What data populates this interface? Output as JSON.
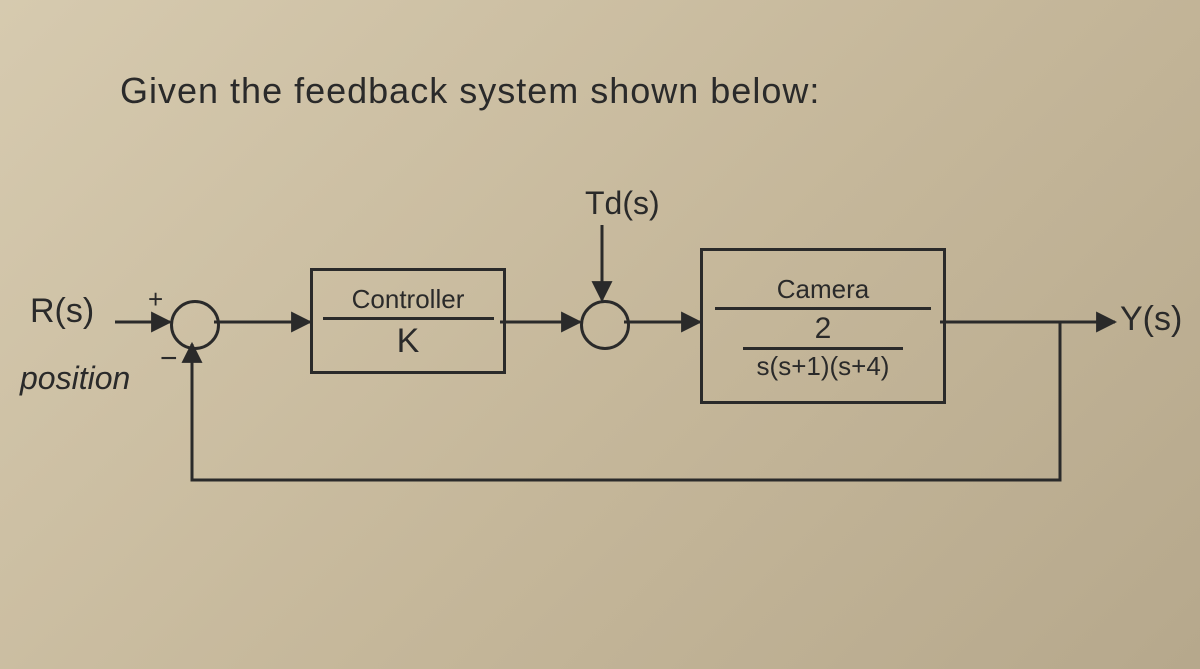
{
  "title": "Given the feedback system shown below:",
  "inputSignal": "R(s)",
  "inputPlus": "+",
  "inputMinus": "−",
  "inputLabel": "position",
  "disturbance": "Td(s)",
  "outputSignal": "Y(s)",
  "controller": {
    "title": "Controller",
    "gain": "K"
  },
  "plant": {
    "title": "Camera",
    "numerator": "2",
    "denominator": "s(s+1)(s+4)"
  },
  "diagram": {
    "type": "block-diagram",
    "nodes": [
      {
        "id": "Rs",
        "kind": "source",
        "label": "R(s)"
      },
      {
        "id": "sum1",
        "kind": "sum",
        "inputs": [
          {
            "from": "Rs",
            "sign": "+"
          },
          {
            "from": "feedback",
            "sign": "-"
          }
        ]
      },
      {
        "id": "ctrl",
        "kind": "block",
        "title": "Controller",
        "tf": "K"
      },
      {
        "id": "sum2",
        "kind": "sum",
        "inputs": [
          {
            "from": "ctrl",
            "sign": "+"
          },
          {
            "from": "Td",
            "sign": "+"
          }
        ]
      },
      {
        "id": "Td",
        "kind": "source",
        "label": "Td(s)"
      },
      {
        "id": "plant",
        "kind": "block",
        "title": "Camera",
        "tf": "2 / (s(s+1)(s+4))"
      },
      {
        "id": "Ys",
        "kind": "sink",
        "label": "Y(s)"
      }
    ],
    "edges": [
      [
        "Rs",
        "sum1"
      ],
      [
        "sum1",
        "ctrl"
      ],
      [
        "ctrl",
        "sum2"
      ],
      [
        "Td",
        "sum2"
      ],
      [
        "sum2",
        "plant"
      ],
      [
        "plant",
        "Ys"
      ],
      [
        "Ys",
        "sum1"
      ]
    ],
    "feedback": "unity-negative"
  }
}
